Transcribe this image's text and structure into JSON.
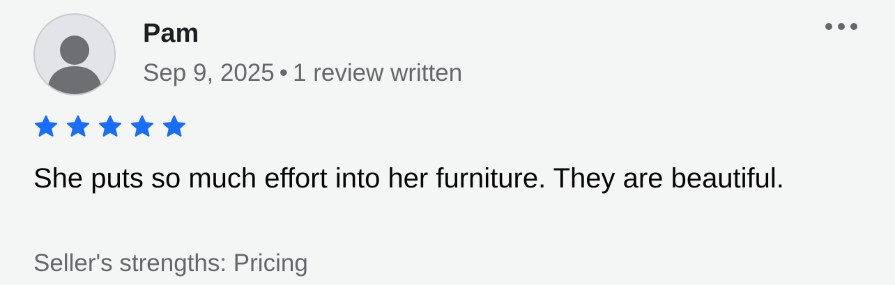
{
  "review": {
    "author": "Pam",
    "date": "Sep 9, 2025",
    "separator": "•",
    "review_count": "1 review written",
    "rating": 5,
    "rating_max": 5,
    "star_color": "#1a6ef5",
    "text": "She puts so much effort into her furniture. They are beautiful.",
    "strengths": "Seller's strengths: Pricing"
  },
  "icons": {
    "avatar": "default-person-avatar",
    "more": "more-horizontal-icon",
    "star": "star-icon"
  }
}
